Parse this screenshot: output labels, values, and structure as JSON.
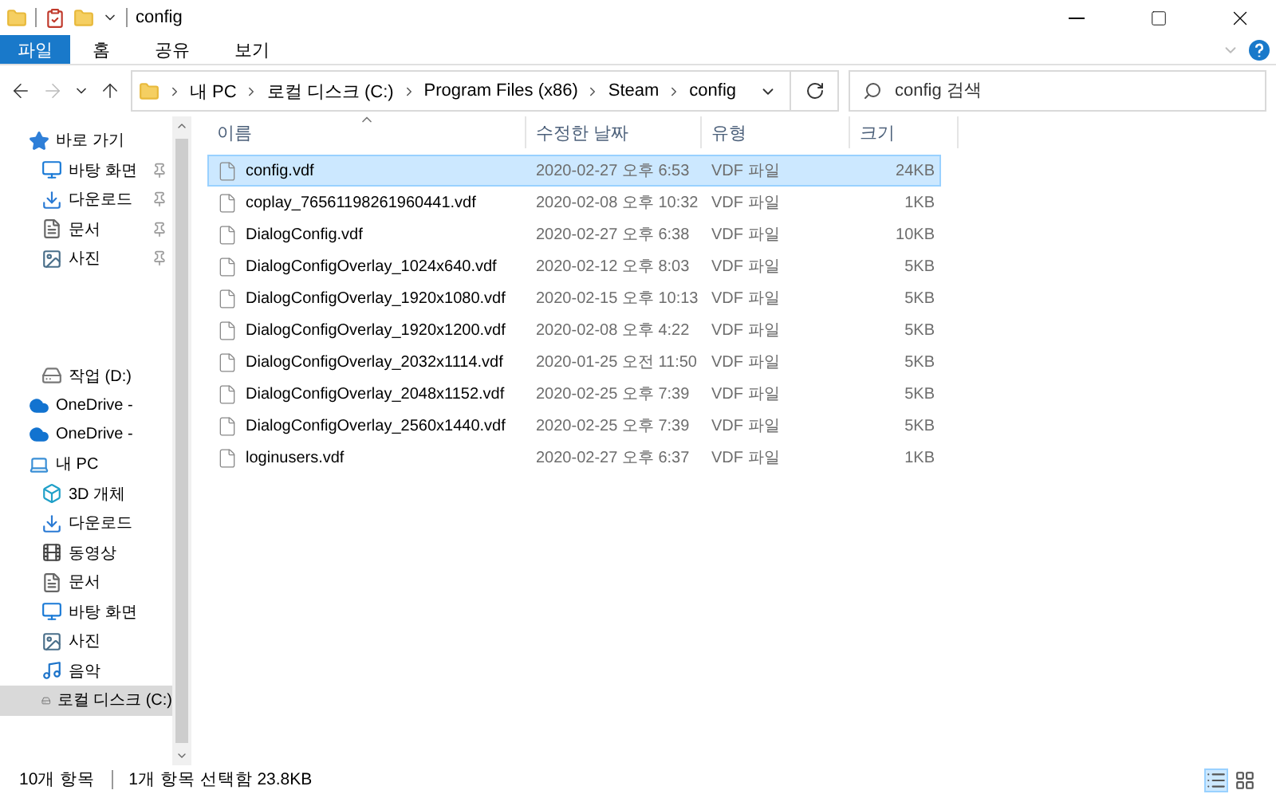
{
  "window": {
    "title": "config"
  },
  "ribbon_tabs": [
    {
      "label": "파일",
      "selected": true
    },
    {
      "label": "홈",
      "selected": false
    },
    {
      "label": "공유",
      "selected": false
    },
    {
      "label": "보기",
      "selected": false
    }
  ],
  "address": {
    "crumbs": [
      "내 PC",
      "로컬 디스크 (C:)",
      "Program Files (x86)",
      "Steam",
      "config"
    ]
  },
  "search": {
    "placeholder": "config 검색"
  },
  "sidebar": {
    "items": [
      {
        "label": "바로 가기",
        "kind": "quick",
        "selected": false,
        "children": [
          {
            "label": "바탕 화면",
            "kind": "desktop",
            "pinned": true,
            "selected": false
          },
          {
            "label": "다운로드",
            "kind": "download",
            "pinned": true,
            "selected": false
          },
          {
            "label": "문서",
            "kind": "document",
            "pinned": true,
            "selected": false
          },
          {
            "label": "사진",
            "kind": "picture",
            "pinned": true,
            "selected": false
          }
        ]
      },
      {
        "label": "작업 (D:)",
        "kind": "drive",
        "selected": false
      },
      {
        "label": "OneDrive -",
        "kind": "cloud",
        "selected": false
      },
      {
        "label": "OneDrive -",
        "kind": "cloud",
        "selected": false
      },
      {
        "label": "내 PC",
        "kind": "pc",
        "selected": false,
        "children": [
          {
            "label": "3D 개체",
            "kind": "cube",
            "pinned": false,
            "selected": false
          },
          {
            "label": "다운로드",
            "kind": "download",
            "pinned": false,
            "selected": false
          },
          {
            "label": "동영상",
            "kind": "video",
            "pinned": false,
            "selected": false
          },
          {
            "label": "문서",
            "kind": "document",
            "pinned": false,
            "selected": false
          },
          {
            "label": "바탕 화면",
            "kind": "desktop",
            "pinned": false,
            "selected": false
          },
          {
            "label": "사진",
            "kind": "picture",
            "pinned": false,
            "selected": false
          },
          {
            "label": "음악",
            "kind": "music",
            "pinned": false,
            "selected": false
          },
          {
            "label": "로컬 디스크 (C:)",
            "kind": "drive",
            "pinned": false,
            "selected": true
          }
        ]
      }
    ]
  },
  "table": {
    "columns": [
      "이름",
      "수정한 날짜",
      "유형",
      "크기"
    ],
    "rows": [
      {
        "name": "config.vdf",
        "date": "2020-02-27 오후 6:53",
        "type": "VDF 파일",
        "size": "24KB",
        "selected": true
      },
      {
        "name": "coplay_76561198261960441.vdf",
        "date": "2020-02-08 오후 10:32",
        "type": "VDF 파일",
        "size": "1KB",
        "selected": false
      },
      {
        "name": "DialogConfig.vdf",
        "date": "2020-02-27 오후 6:38",
        "type": "VDF 파일",
        "size": "10KB",
        "selected": false
      },
      {
        "name": "DialogConfigOverlay_1024x640.vdf",
        "date": "2020-02-12 오후 8:03",
        "type": "VDF 파일",
        "size": "5KB",
        "selected": false
      },
      {
        "name": "DialogConfigOverlay_1920x1080.vdf",
        "date": "2020-02-15 오후 10:13",
        "type": "VDF 파일",
        "size": "5KB",
        "selected": false
      },
      {
        "name": "DialogConfigOverlay_1920x1200.vdf",
        "date": "2020-02-08 오후 4:22",
        "type": "VDF 파일",
        "size": "5KB",
        "selected": false
      },
      {
        "name": "DialogConfigOverlay_2032x1114.vdf",
        "date": "2020-01-25 오전 11:50",
        "type": "VDF 파일",
        "size": "5KB",
        "selected": false
      },
      {
        "name": "DialogConfigOverlay_2048x1152.vdf",
        "date": "2020-02-25 오후 7:39",
        "type": "VDF 파일",
        "size": "5KB",
        "selected": false
      },
      {
        "name": "DialogConfigOverlay_2560x1440.vdf",
        "date": "2020-02-25 오후 7:39",
        "type": "VDF 파일",
        "size": "5KB",
        "selected": false
      },
      {
        "name": "loginusers.vdf",
        "date": "2020-02-27 오후 6:37",
        "type": "VDF 파일",
        "size": "1KB",
        "selected": false
      }
    ]
  },
  "status_bar": {
    "count": "10개 항목",
    "selection": "1개 항목 선택함 23.8KB"
  }
}
